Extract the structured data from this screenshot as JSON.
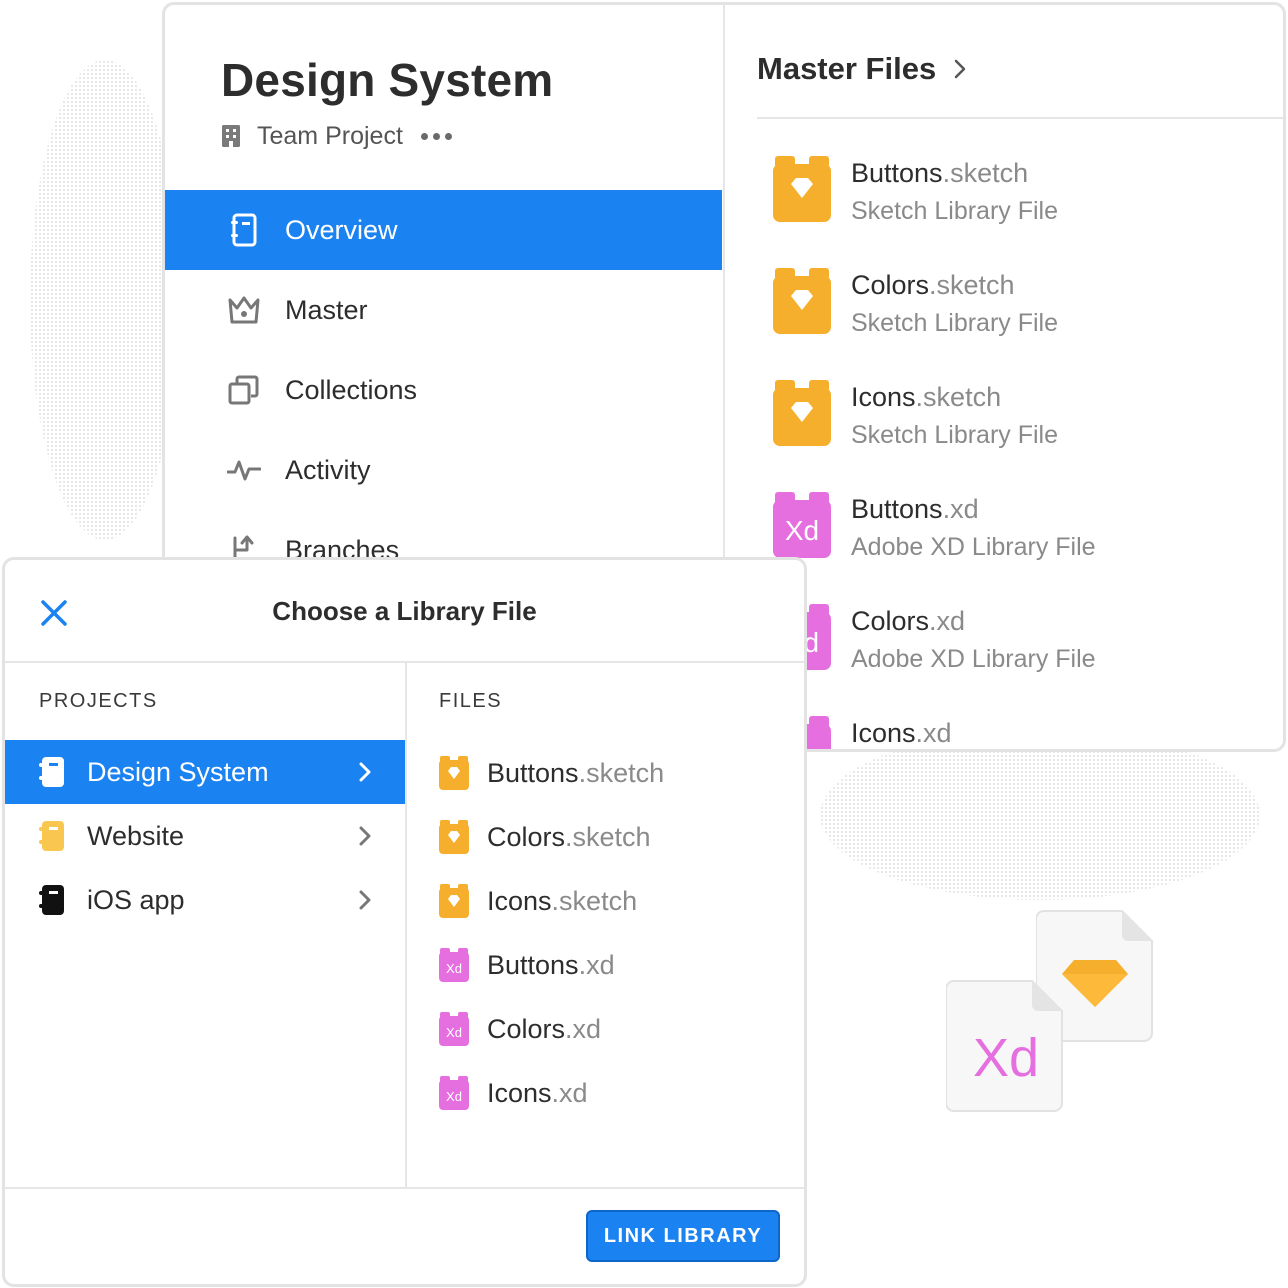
{
  "sidebar": {
    "title": "Design System",
    "subtitle": "Team Project",
    "nav": [
      {
        "label": "Overview",
        "icon": "notebook-icon",
        "active": true
      },
      {
        "label": "Master",
        "icon": "crown-icon",
        "active": false
      },
      {
        "label": "Collections",
        "icon": "collections-icon",
        "active": false
      },
      {
        "label": "Activity",
        "icon": "activity-icon",
        "active": false
      },
      {
        "label": "Branches",
        "icon": "branches-icon",
        "active": false
      }
    ]
  },
  "master_files": {
    "title": "Master Files",
    "files": [
      {
        "name": "Buttons",
        "ext": ".sketch",
        "type": "Sketch Library File",
        "kind": "sketch"
      },
      {
        "name": "Colors",
        "ext": ".sketch",
        "type": "Sketch Library File",
        "kind": "sketch"
      },
      {
        "name": "Icons",
        "ext": ".sketch",
        "type": "Sketch Library File",
        "kind": "sketch"
      },
      {
        "name": "Buttons",
        "ext": ".xd",
        "type": "Adobe XD Library File",
        "kind": "xd"
      },
      {
        "name": "Colors",
        "ext": ".xd",
        "type": "Adobe XD Library File",
        "kind": "xd"
      },
      {
        "name": "Icons",
        "ext": ".xd",
        "type": "",
        "kind": "xd"
      }
    ]
  },
  "dialog": {
    "title": "Choose a Library File",
    "projects_label": "PROJECTS",
    "files_label": "FILES",
    "projects": [
      {
        "label": "Design System",
        "active": true,
        "color": "#ffffff"
      },
      {
        "label": "Website",
        "active": false,
        "color": "#f9c74f"
      },
      {
        "label": "iOS app",
        "active": false,
        "color": "#111111"
      }
    ],
    "files": [
      {
        "name": "Buttons",
        "ext": ".sketch",
        "kind": "sketch"
      },
      {
        "name": "Colors",
        "ext": ".sketch",
        "kind": "sketch"
      },
      {
        "name": "Icons",
        "ext": ".sketch",
        "kind": "sketch"
      },
      {
        "name": "Buttons",
        "ext": ".xd",
        "kind": "xd"
      },
      {
        "name": "Colors",
        "ext": ".xd",
        "kind": "xd"
      },
      {
        "name": "Icons",
        "ext": ".xd",
        "kind": "xd"
      }
    ],
    "button_label": "LINK LIBRARY"
  },
  "illustration": {
    "xd_text": "Xd"
  },
  "colors": {
    "accent": "#1a82f1",
    "sketch": "#f6ae2d",
    "sketch_light": "#fdd07a",
    "xd": "#e66fe0",
    "xd_light": "#f2a6ee"
  }
}
